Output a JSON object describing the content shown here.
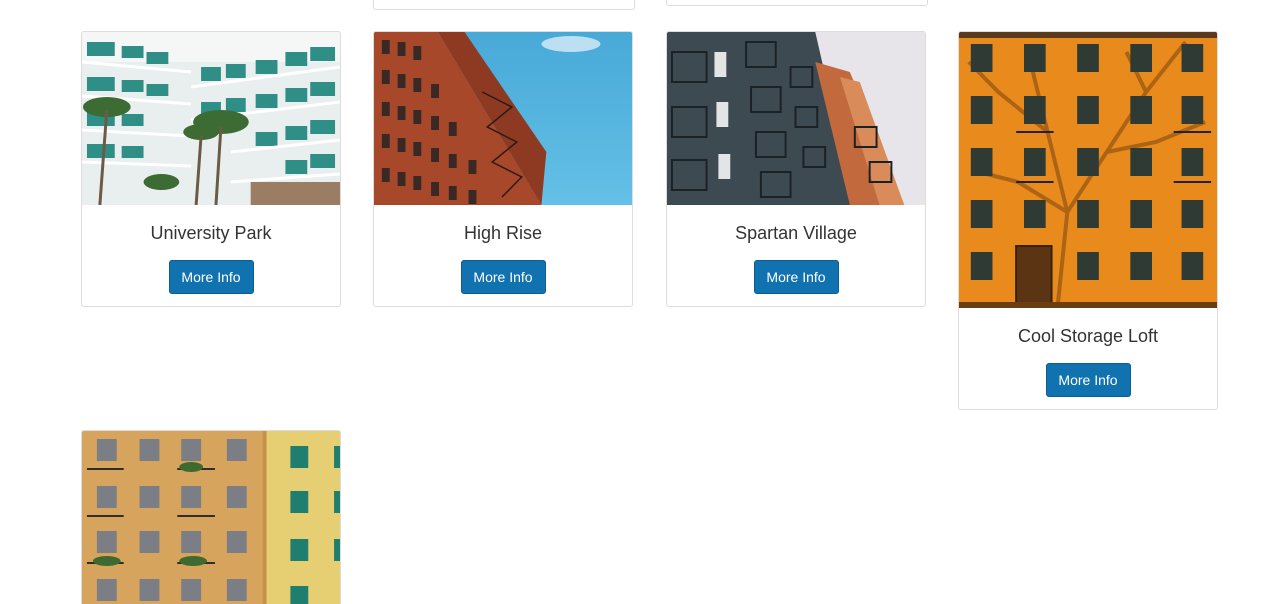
{
  "colors": {
    "button_bg": "#1172b0",
    "button_text": "#ffffff",
    "title_text": "#333333",
    "card_border": "#dcdcdc"
  },
  "listings": [
    {
      "title": "University Park",
      "button_label": "More Info",
      "photo": "white-balcony-hotel-with-palms"
    },
    {
      "title": "High Rise",
      "button_label": "More Info",
      "photo": "red-brick-building-blue-sky"
    },
    {
      "title": "Spartan Village",
      "button_label": "More Info",
      "photo": "dark-balcony-apartments"
    },
    {
      "title": "Cool Storage Loft",
      "button_label": "More Info",
      "photo": "orange-building-tree-shadow"
    },
    {
      "title": "",
      "button_label": "",
      "photo": "ochre-apartment-facade"
    }
  ]
}
